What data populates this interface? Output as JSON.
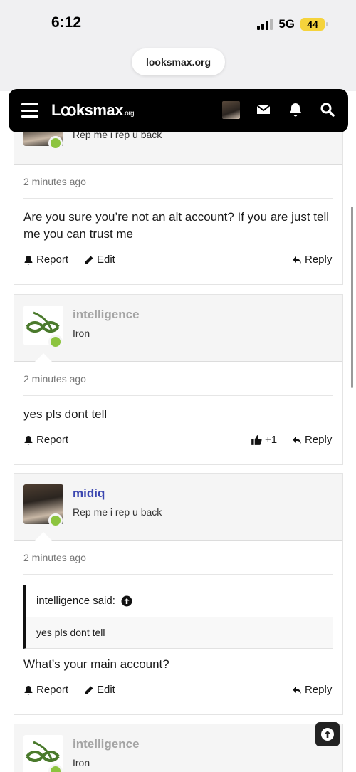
{
  "status": {
    "time": "6:12",
    "network": "5G",
    "battery": "44"
  },
  "browser": {
    "url": "looksmax.org"
  },
  "site": {
    "logo_main": "Lꝏksmax",
    "logo_suffix": ".org"
  },
  "posts": [
    {
      "username": "",
      "usertitle": "Rep me i rep u back",
      "date": "2 minutes ago",
      "body": "Are you sure you’re not an alt account? If you are just tell me you can trust me",
      "actions": {
        "report": "Report",
        "edit": "Edit",
        "reply": "Reply"
      }
    },
    {
      "username": "intelligence",
      "usertitle": "Iron",
      "date": "2 minutes ago",
      "body": "yes pls dont tell",
      "actions": {
        "report": "Report",
        "reaction": "+1",
        "reply": "Reply"
      }
    },
    {
      "username": "midiq",
      "usertitle": "Rep me i rep u back",
      "date": "2 minutes ago",
      "quote_author": "intelligence said:",
      "quote_text": "yes pls dont tell",
      "body": "What’s your main account?",
      "actions": {
        "report": "Report",
        "edit": "Edit",
        "reply": "Reply"
      }
    },
    {
      "username": "intelligence",
      "usertitle": "Iron"
    }
  ],
  "colors": {
    "online": "#8cc43f",
    "username_member": "#3b46b0",
    "username_grey": "#a4a4a4",
    "nav_bg": "#000000"
  }
}
